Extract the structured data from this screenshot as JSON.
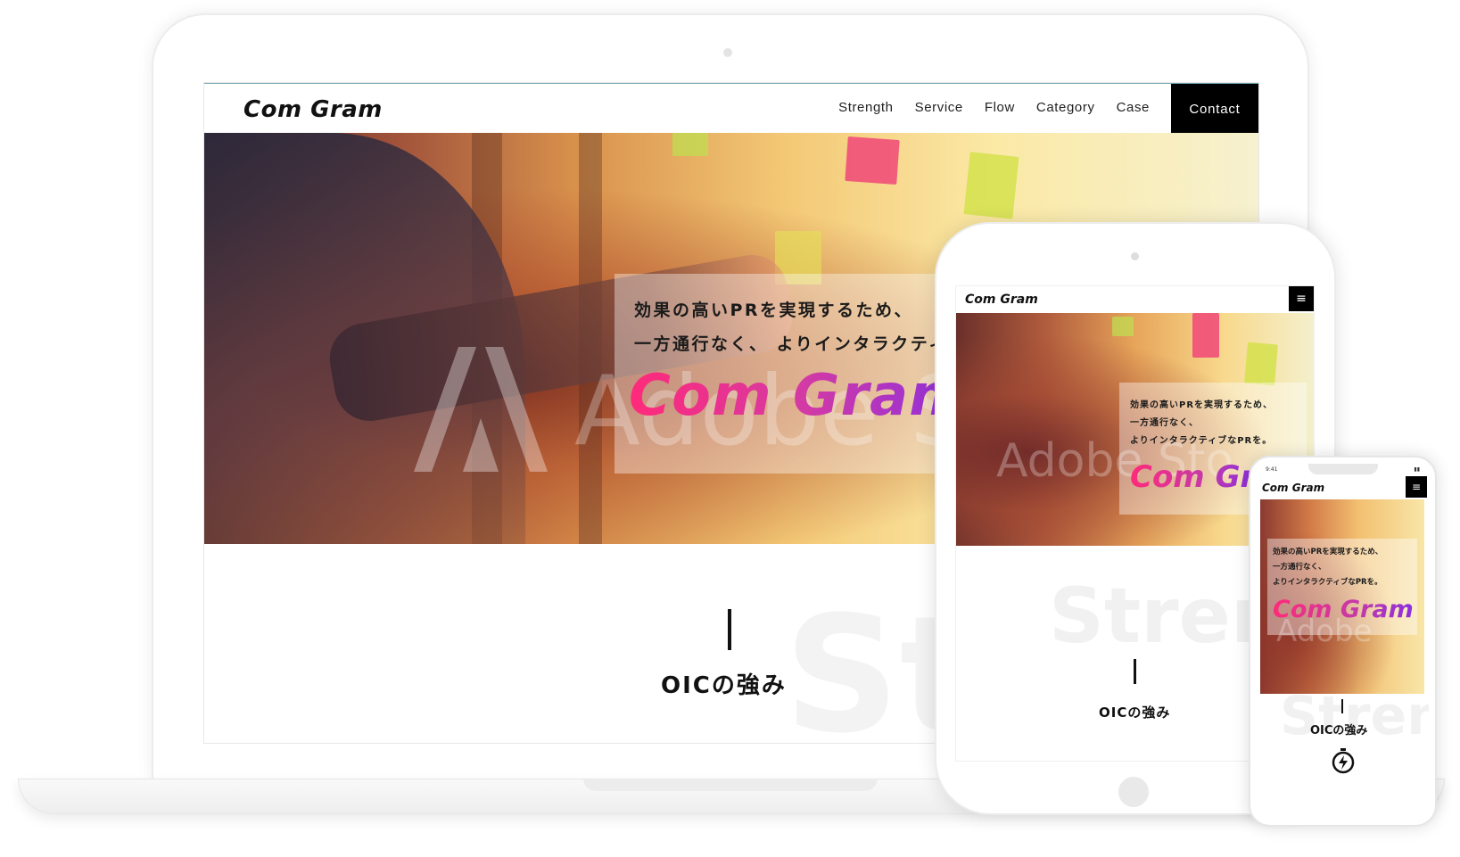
{
  "brand": "Com Gram",
  "nav": {
    "items": [
      "Strength",
      "Service",
      "Flow",
      "Category",
      "Case"
    ],
    "contact": "Contact"
  },
  "hero": {
    "line1": "効果の高いPRを実現するため、",
    "line2": "一方通行なく、 よりインタラクティ",
    "brand": "Com Gram",
    "watermark": "Adobe St"
  },
  "section": {
    "bg_text": "Str",
    "title": "OICの強み"
  },
  "tablet": {
    "logo": "Com Gram",
    "menu_icon": "≡",
    "line1": "効果の高いPRを実現するため、",
    "line2": "一方通行なく、",
    "line3": "よりインタラクティブなPRを。",
    "brand": "Com Gr",
    "watermark": "Adobe Sto",
    "bg_text": "Stren",
    "section_title": "OICの強み"
  },
  "phone": {
    "time": "9:41",
    "logo": "Com Gram",
    "menu_icon": "≡",
    "line1": "効果の高いPRを実現するため、",
    "line2": "一方通行なく、",
    "line3": "よりインタラクティブなPRを。",
    "brand": "Com Gram",
    "watermark": "Adobe",
    "bg_text": "Stren",
    "section_title": "OICの強み",
    "feature_icon": "stopwatch-icon"
  },
  "colors": {
    "brand_gradient_start": "#ff2a7a",
    "brand_gradient_end": "#8a2fe0",
    "contact_bg": "#000000"
  }
}
